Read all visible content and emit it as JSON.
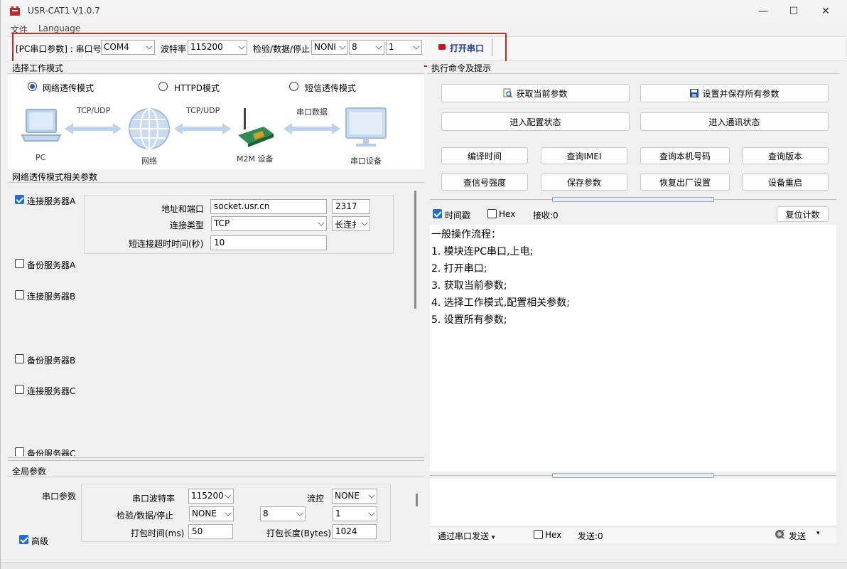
{
  "window": {
    "title": "USR-CAT1 V1.0.7",
    "minimize": "—",
    "maximize": "☐",
    "close": "✕"
  },
  "menu": [
    "文件",
    "Language"
  ],
  "serial_params": {
    "prefix": "[PC串口参数] : 串口号",
    "port": "COM4",
    "baud_label": "波特率",
    "baud": "115200",
    "parity_label": "检验/数据/停止",
    "parity": "NONI",
    "databits": "8",
    "stopbits": "1",
    "open_button": "打开串口",
    "status_color": "#d01010"
  },
  "work_mode": {
    "header": "选择工作模式",
    "modes": [
      {
        "label": "网络透传模式",
        "selected": true
      },
      {
        "label": "HTTPD模式",
        "selected": false
      },
      {
        "label": "短信透传模式",
        "selected": false
      }
    ],
    "diagram": {
      "pc": "PC",
      "link1": "TCP/UDP",
      "network": "网络",
      "link2": "TCP/UDP",
      "m2m": "M2M 设备",
      "link3": "串口数据",
      "serial_device": "串口设备"
    }
  },
  "net_params": {
    "header": "网络透传模式相关参数",
    "servers": [
      {
        "label": "连接服务器A",
        "checked": true
      },
      {
        "label": "备份服务器A",
        "checked": false
      },
      {
        "label": "连接服务器B",
        "checked": false
      },
      {
        "label": "备份服务器B",
        "checked": false
      },
      {
        "label": "连接服务器C",
        "checked": false
      },
      {
        "label": "备份服务器C",
        "checked": false
      }
    ],
    "addr_label": "地址和端口",
    "addr": "socket.usr.cn",
    "port": "2317",
    "conn_type_label": "连接类型",
    "conn_type": "TCP",
    "conn_mode": "长连扌",
    "timeout_label": "短连接超时时间(秒)",
    "timeout": "10"
  },
  "global_params": {
    "header": "全局参数",
    "serial_label": "串口参数",
    "baud_label": "串口波特率",
    "baud": "115200",
    "flow_label": "流控",
    "flow": "NONE",
    "parity_label": "检验/数据/停止",
    "parity": "NONE",
    "databits": "8",
    "stopbits": "1",
    "pack_time_label": "打包时间(ms)",
    "pack_time": "50",
    "pack_len_label": "打包长度(Bytes)",
    "pack_len": "1024",
    "advanced_label": "高级",
    "advanced_checked": true
  },
  "commands": {
    "header": "执行命令及提示",
    "get_params": "获取当前参数",
    "save_all": "设置并保存所有参数",
    "enter_config": "进入配置状态",
    "enter_comm": "进入通讯状态",
    "compile_time": "编译时间",
    "query_imei": "查询IMEI",
    "query_number": "查询本机号码",
    "query_version": "查询版本",
    "signal": "查信号强度",
    "save_params": "保存参数",
    "factory_reset": "恢复出厂设置",
    "reboot": "设备重启"
  },
  "log": {
    "timestamp_label": "时间戳",
    "timestamp_checked": true,
    "hex_label": "Hex",
    "hex_checked": false,
    "recv_label": "接收:0",
    "reset_count": "复位计数",
    "lines": [
      "一般操作流程：",
      "1. 模块连PC串口,上电;",
      "2. 打开串口;",
      "3. 获取当前参数;",
      "4. 选择工作模式,配置相关参数;",
      "5. 设置所有参数;"
    ]
  },
  "send": {
    "via_label": "通过串口发送",
    "hex_label": "Hex",
    "sent_label": "发送:0",
    "send_button": "发送"
  }
}
